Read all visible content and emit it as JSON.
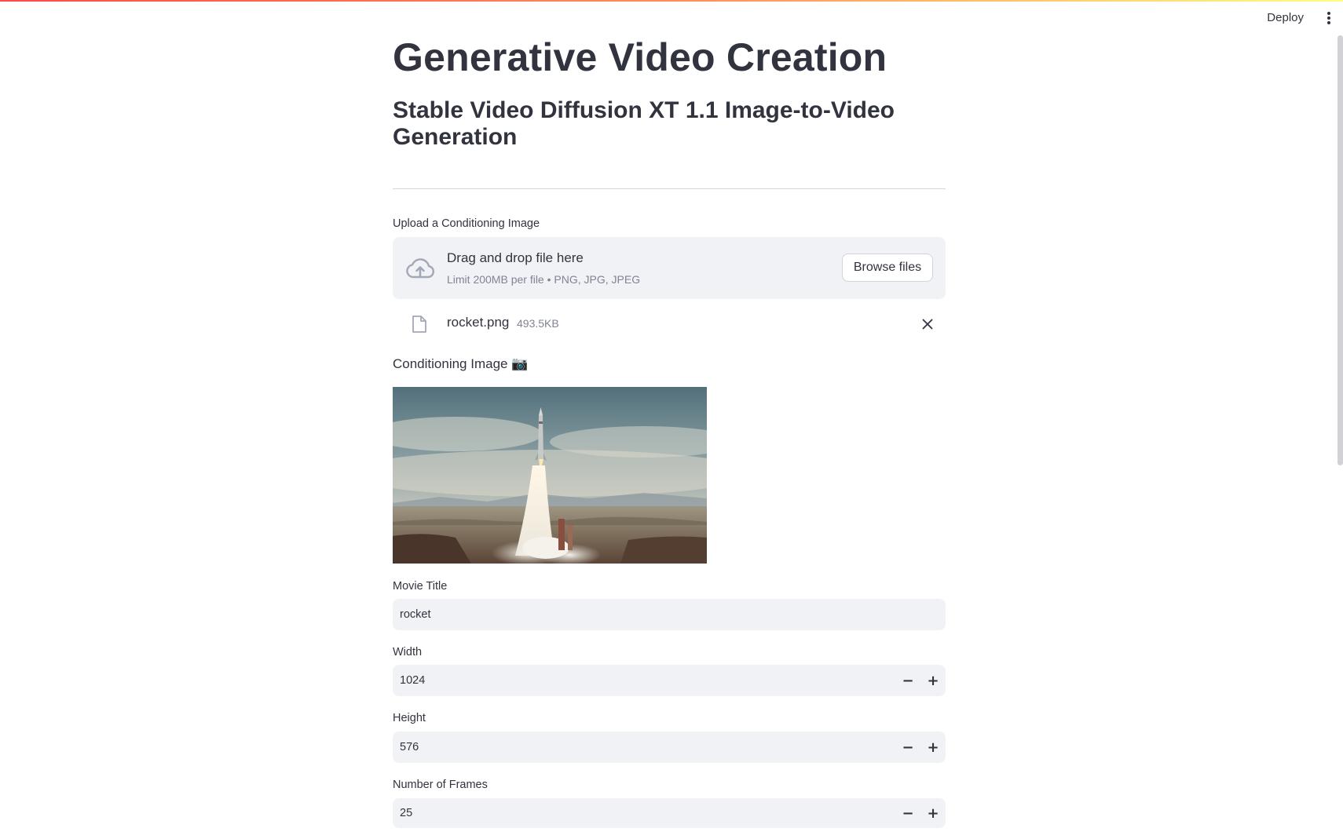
{
  "header": {
    "deploy_label": "Deploy",
    "menu_icon": "more-vertical-icon"
  },
  "page": {
    "title": "Generative Video Creation",
    "subtitle": "Stable Video Diffusion XT 1.1 Image-to-Video Generation"
  },
  "uploader": {
    "label": "Upload a Conditioning Image",
    "drop_text": "Drag and drop file here",
    "limit_text": "Limit 200MB per file • PNG, JPG, JPEG",
    "browse_label": "Browse files",
    "icon": "cloud-upload-icon"
  },
  "uploaded_file": {
    "name": "rocket.png",
    "size": "493.5KB",
    "icon": "file-icon",
    "remove_icon": "close-icon"
  },
  "conditioning_image": {
    "label": "Conditioning Image 📷"
  },
  "form": {
    "movie_title": {
      "label": "Movie Title",
      "value": "rocket"
    },
    "width": {
      "label": "Width",
      "value": "1024"
    },
    "height": {
      "label": "Height",
      "value": "576"
    },
    "frames": {
      "label": "Number of Frames",
      "value": "25"
    },
    "minus_label": "−",
    "plus_label": "+"
  },
  "colors": {
    "accent": "#ff4b4b",
    "input_bg": "#f0f2f6",
    "text": "#31333f",
    "muted": "#808495"
  }
}
